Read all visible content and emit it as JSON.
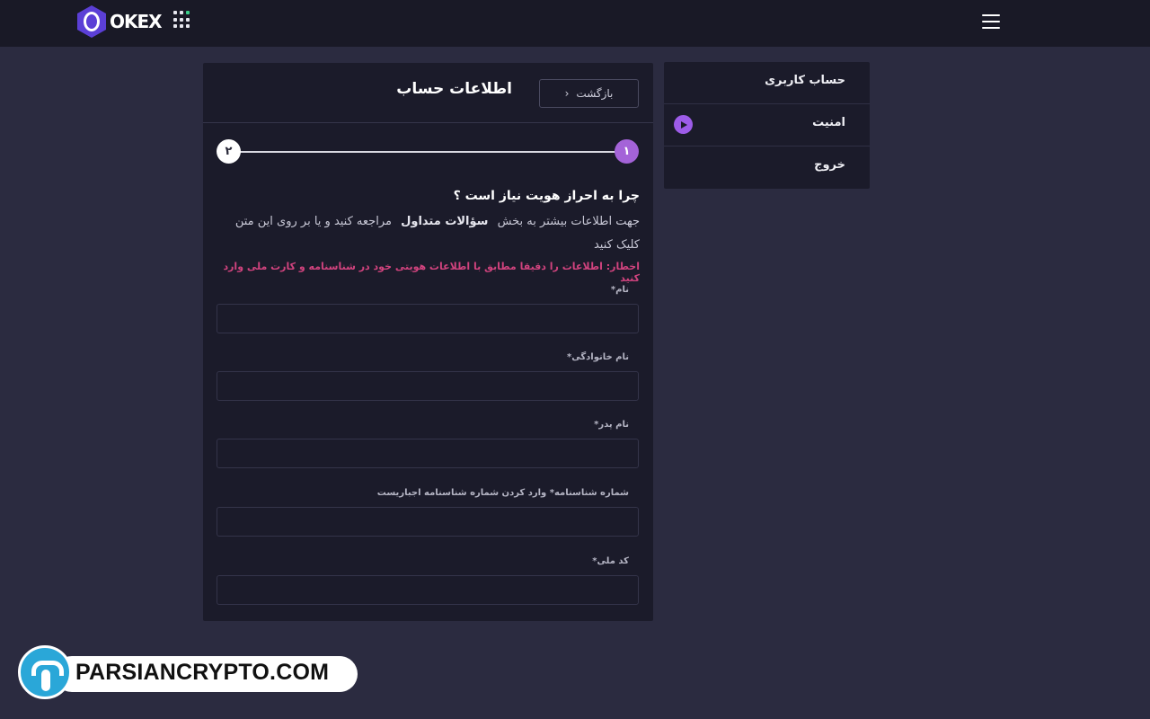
{
  "header": {
    "logo_text": "OKEX",
    "icons": {
      "apps": "apps-grid-icon",
      "menu": "hamburger-menu-icon"
    }
  },
  "sidebar": {
    "items": [
      {
        "label": "حساب کاربری"
      },
      {
        "label": "امنیت",
        "icon": "play-circle-icon"
      },
      {
        "label": "خروج"
      }
    ]
  },
  "card": {
    "title": "اطلاعات حساب",
    "back_label": "بازگشت",
    "steps": [
      "۱",
      "۲"
    ],
    "why_title": "چرا به احراز هویت نیاز است ؟",
    "info_before": "جهت اطلاعات بیشتر به بخش",
    "faq_link": "سؤالات متداول",
    "info_after": "مراجعه کنید و یا بر روی این متن کلیک کنید",
    "warning": "اخطار: اطلاعات را دقیقا مطابق با اطلاعات هویتی خود در شناسنامه و کارت ملی وارد کنید",
    "fields": [
      {
        "label": "نام*",
        "value": ""
      },
      {
        "label": "نام خانوادگی*",
        "value": ""
      },
      {
        "label": "نام پدر*",
        "value": ""
      },
      {
        "label": "شماره شناسنامه* وارد کردن شماره شناسنامه اجباریست",
        "value": ""
      },
      {
        "label": "کد ملی*",
        "value": ""
      }
    ]
  },
  "watermark": {
    "text": "PARSIANCRYPTO.COM"
  },
  "colors": {
    "background": "#2b2b40",
    "topbar": "#191926",
    "panel": "#1b1b2a",
    "accent": "#a463d8",
    "warning": "#d1437e"
  }
}
